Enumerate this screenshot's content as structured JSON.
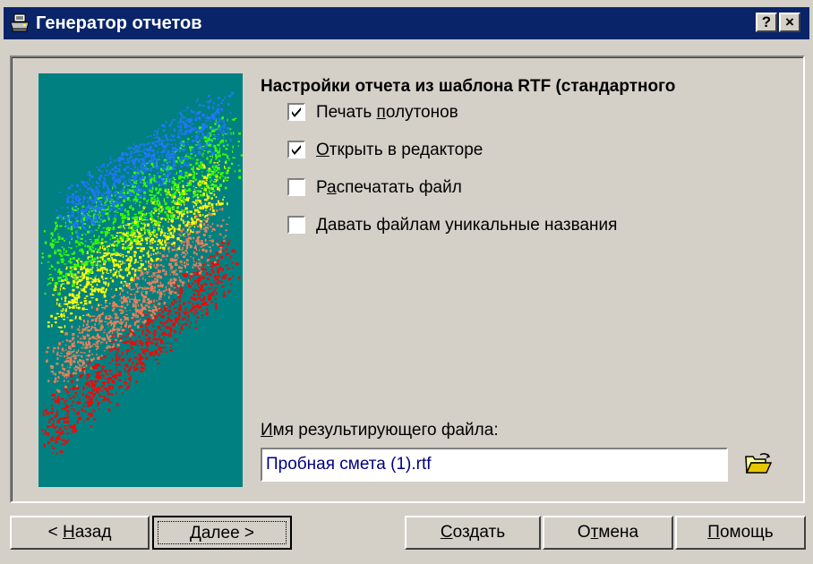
{
  "window": {
    "title": "Генератор отчетов",
    "help_button": "?",
    "close_button": "×",
    "icon": "printer-icon"
  },
  "panel": {
    "heading": "Настройки отчета из шаблона RTF (стандартного",
    "options": [
      {
        "pre": "Печать ",
        "mnemonic": "п",
        "post": "олутонов",
        "checked": true
      },
      {
        "pre": "",
        "mnemonic": "О",
        "post": "ткрыть в редакторе",
        "checked": true
      },
      {
        "pre": "Р",
        "mnemonic": "а",
        "post": "спечатать файл",
        "checked": false
      },
      {
        "pre": "",
        "mnemonic": "Д",
        "post": "авать файлам уникальные названия",
        "checked": false
      }
    ],
    "file_label": {
      "pre": "",
      "mnemonic": "И",
      "post": "мя результирующего файла:"
    },
    "file_value": "Пробная смета (1).rtf",
    "browse_icon": "open-folder-icon"
  },
  "buttons": {
    "back": {
      "pre": "< ",
      "mnemonic": "Н",
      "post": "азад"
    },
    "next": {
      "pre": "",
      "mnemonic": "Д",
      "post": "алее >"
    },
    "create": {
      "pre": "",
      "mnemonic": "С",
      "post": "оздать"
    },
    "cancel": {
      "pre": "О",
      "mnemonic": "т",
      "post": "мена"
    },
    "help": {
      "pre": "",
      "mnemonic": "П",
      "post": "омощь"
    }
  },
  "colors": {
    "titlebar": "#0a246a",
    "face": "#d4d0c8",
    "image_background": "#008080",
    "input_text": "#000080"
  }
}
